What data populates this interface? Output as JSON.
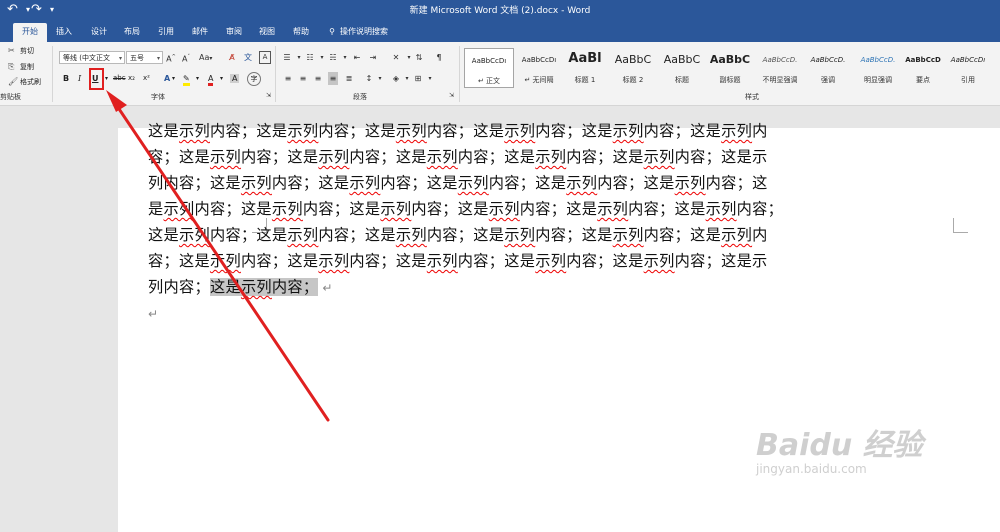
{
  "titlebar": {
    "undo_icon": "undo-icon",
    "redo_icon": "redo-icon",
    "customize_icon": "dropdown-icon",
    "title": "新建 Microsoft Word 文档 (2).docx  -  Word"
  },
  "tabs": [
    "开始",
    "插入",
    "设计",
    "布局",
    "引用",
    "邮件",
    "审阅",
    "视图",
    "帮助"
  ],
  "tell_me": "操作说明搜索",
  "clipboard": {
    "cut": "剪切",
    "copy": "复制",
    "format_painter": "格式刷",
    "group_label": "剪贴板"
  },
  "font": {
    "font_name": "等线 (中文正文",
    "font_size": "五号",
    "grow": "A",
    "shrink": "A",
    "change_case": "Aa",
    "bold": "B",
    "italic": "I",
    "underline": "U",
    "strike": "abc",
    "subscript": "x₂",
    "superscript": "x²",
    "font_color": "A",
    "group_label": "字体"
  },
  "paragraph": {
    "group_label": "段落"
  },
  "styles": {
    "group_label": "样式",
    "items": [
      {
        "preview": "AaBbCcDı",
        "name": "↵ 正文"
      },
      {
        "preview": "AaBbCcDı",
        "name": "↵ 无间隔"
      },
      {
        "preview": "AaBl",
        "name": "标题 1"
      },
      {
        "preview": "AaBbC",
        "name": "标题 2"
      },
      {
        "preview": "AaBbC",
        "name": "标题"
      },
      {
        "preview": "AaBbC",
        "name": "副标题"
      },
      {
        "preview": "AaBbCcD.",
        "name": "不明显强调"
      },
      {
        "preview": "AaBbCcD.",
        "name": "强调"
      },
      {
        "preview": "AaBbCcD.",
        "name": "明显强调"
      },
      {
        "preview": "AaBbCcD",
        "name": "要点"
      },
      {
        "preview": "AaBbCcDı",
        "name": "引用"
      }
    ]
  },
  "document": {
    "lines": [
      "这是示列内容；这是示列内容；这是示列内容；这是示列内容；这是示列内容；这是示列内",
      "容；这是示列内容；这是示列内容；这是示列内容；这是示列内容；这是示列内容；这是示",
      "列内容；这是示列内容；这是示列内容；这是示列内容；这是示列内容；这是示列内容；这",
      "是示列内容；这是示列内容；这是示列内容；这是示列内容；这是示列内容；这是示列内容；",
      "这是示列内容；这是示列内容；这是示列内容；这是示列内容；这是示列内容；这是示列内",
      "容；这是示列内容；这是示列内容；这是示列内容；这是示列内容；这是示列内容；这是示"
    ],
    "last_line_plain": "列内容；",
    "last_line_selected": "这是示列内容；",
    "paragraph_mark": "↵"
  },
  "watermark": {
    "logo": "Baidu 经验",
    "url": "jingyan.baidu.com"
  },
  "colors": {
    "accent": "#2b579a",
    "annotation": "#e02020",
    "selection": "#c6c6c6"
  }
}
